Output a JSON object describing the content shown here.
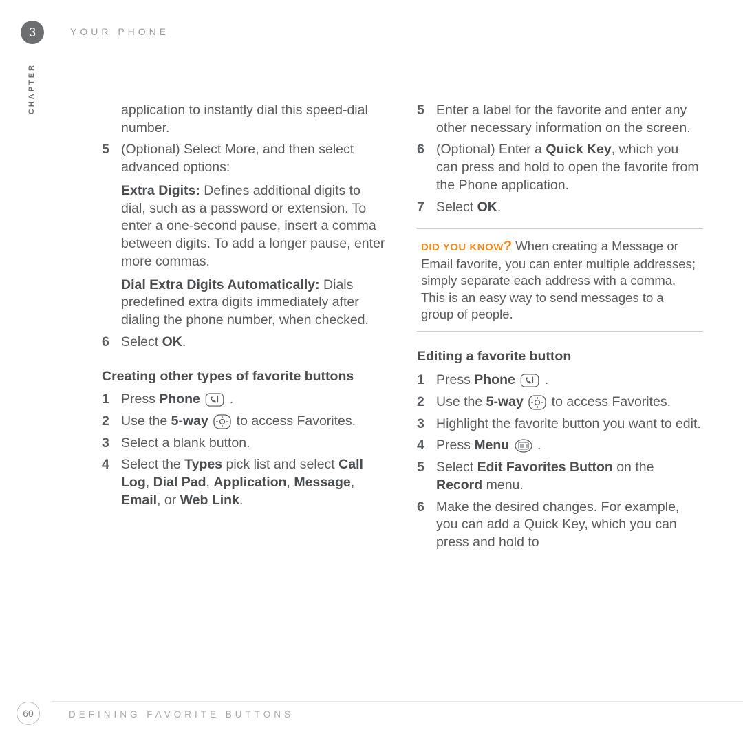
{
  "header": {
    "chapter_badge": "3",
    "title": "YOUR PHONE",
    "chapter_label": "CHAPTER"
  },
  "left": {
    "intro": "application to instantly dial this speed-dial number.",
    "step5_label": "5",
    "step5_body": "(Optional) Select More, and then select advanced options:",
    "extra_label": "Extra Digits:",
    "extra_body": " Defines additional digits to dial, such as a password or extension. To enter a one-second pause, insert a comma between digits. To add a longer pause, enter more commas.",
    "dial_label": "Dial Extra Digits Automatically:",
    "dial_body": " Dials predefined extra digits immediately after dialing the phone number, when checked.",
    "step6_label": "6",
    "step6_pre": "Select ",
    "step6_b": "OK",
    "step6_post": ".",
    "sectionA": "Creating other types of favorite buttons",
    "A1_label": "1",
    "A1_pre": "Press ",
    "A1_b": "Phone",
    "A1_post": " .",
    "A2_label": "2",
    "A2_pre": "Use the ",
    "A2_b": "5-way",
    "A2_post": " to access Favorites.",
    "A3_label": "3",
    "A3_body": "Select a blank button.",
    "A4_label": "4",
    "A4_pre": "Select the ",
    "A4_b1": "Types",
    "A4_mid": " pick list and select ",
    "A4_b2": "Call Log",
    "A4_c1": ", ",
    "A4_b3": "Dial Pad",
    "A4_c2": ", ",
    "A4_b4": "Application",
    "A4_c3": ", ",
    "A4_b5": "Message",
    "A4_c4": ", ",
    "A4_b6": "Email",
    "A4_c5": ", or ",
    "A4_b7": "Web Link",
    "A4_post": "."
  },
  "right": {
    "step5_label": "5",
    "step5_body": "Enter a label for the favorite and enter any other necessary information on the screen.",
    "step6_label": "6",
    "step6_pre": "(Optional)  Enter a ",
    "step6_b": "Quick Key",
    "step6_post": ", which you can press and hold to open the favorite from the Phone application.",
    "step7_label": "7",
    "step7_pre": "Select ",
    "step7_b": "OK",
    "step7_post": ".",
    "callout_label": "DID YOU KNOW",
    "callout_q": "?",
    "callout_body": "  When creating a Message or Email favorite, you can enter multiple addresses; simply separate each address with a comma. This is an easy way to send messages to a group of people.",
    "sectionB": "Editing a favorite button",
    "B1_label": "1",
    "B1_pre": "Press ",
    "B1_b": "Phone",
    "B1_post": " .",
    "B2_label": "2",
    "B2_pre": "Use the ",
    "B2_b": "5-way",
    "B2_post": " to access Favorites.",
    "B3_label": "3",
    "B3_body": "Highlight the favorite button you want to edit.",
    "B4_label": "4",
    "B4_pre": "Press ",
    "B4_b": "Menu",
    "B4_post": " .",
    "B5_label": "5",
    "B5_pre": "Select ",
    "B5_b1": "Edit Favorites Button",
    "B5_mid": " on the ",
    "B5_b2": "Record",
    "B5_post": " menu.",
    "B6_label": "6",
    "B6_body": "Make the desired changes. For example, you can add a Quick Key, which you can press and hold to"
  },
  "footer": {
    "page": "60",
    "title": "DEFINING FAVORITE BUTTONS"
  }
}
